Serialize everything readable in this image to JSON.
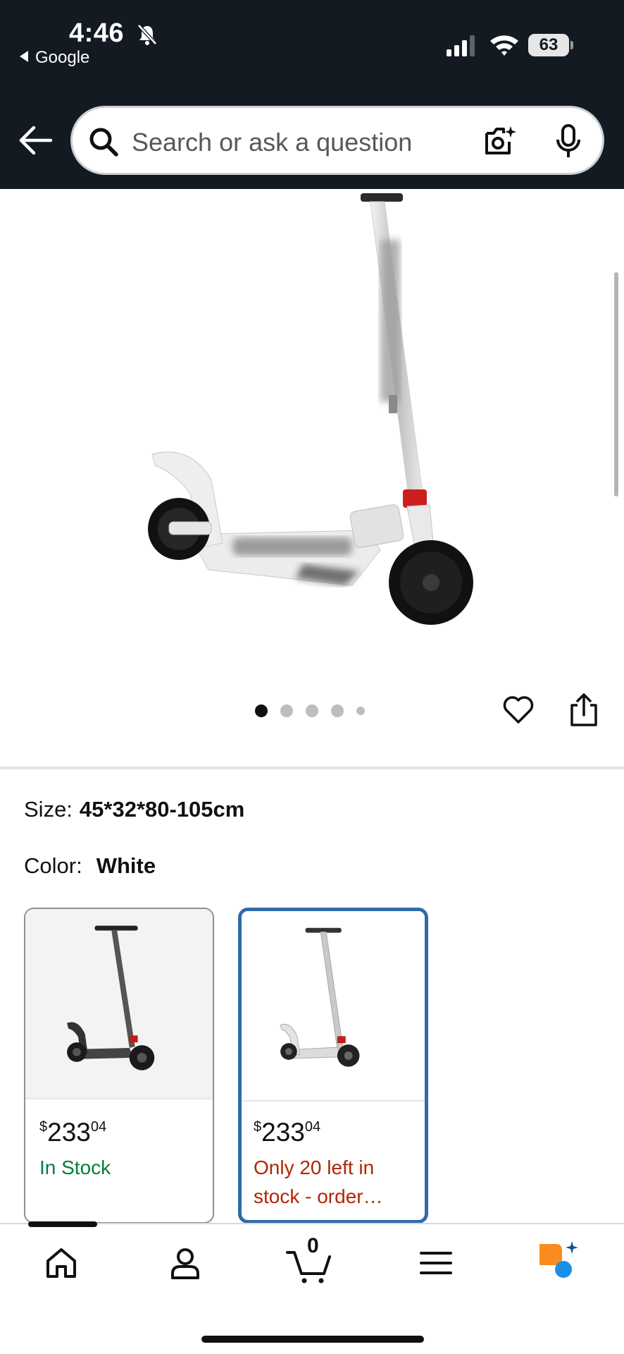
{
  "status_bar": {
    "time": "4:46",
    "back_app": "Google",
    "battery": "63"
  },
  "search": {
    "placeholder": "Search or ask a question"
  },
  "carousel": {
    "total_dots": 5,
    "active_index": 0
  },
  "product": {
    "size_label": "Size:",
    "size_value": "45*32*80-105cm",
    "color_label": "Color:",
    "color_value": "White"
  },
  "variants": [
    {
      "color": "black",
      "price_symbol": "$",
      "price_whole": "233",
      "price_fraction": "04",
      "stock_text": "In Stock",
      "selected": false
    },
    {
      "color": "white",
      "price_symbol": "$",
      "price_whole": "233",
      "price_fraction": "04",
      "stock_text": "Only 20 left in stock - order…",
      "selected": true
    }
  ],
  "bottom_nav": {
    "items": [
      "home-icon",
      "account-icon",
      "cart-icon",
      "menu-icon",
      "rufus-icon"
    ],
    "cart_count": "0",
    "active_index": 0
  },
  "colors": {
    "header_bg": "#131a22",
    "in_stock": "#067d3e",
    "low_stock": "#b12704",
    "selected_border": "#2f6ba8",
    "rufus_orange": "#f98b1f",
    "rufus_blue": "#1b8fe8"
  }
}
